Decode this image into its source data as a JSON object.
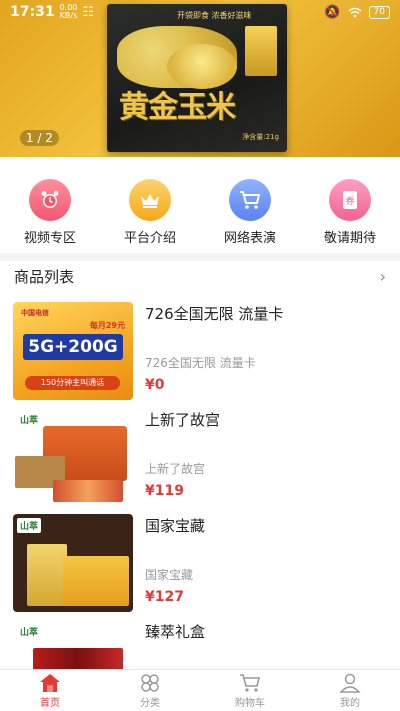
{
  "status_bar": {
    "time": "17:31",
    "speed": "0.00",
    "speed_unit": "KB/s",
    "battery": "70"
  },
  "banner": {
    "page_indicator": "1 / 2",
    "product_name": "黄金玉米",
    "tagline": "开袋即食 浓香好滋味",
    "weight": "净含量:21g"
  },
  "quick_nav": [
    {
      "label": "视频专区",
      "icon": "alarm-clock-icon",
      "color": "#f2576e"
    },
    {
      "label": "平台介绍",
      "icon": "crown-icon",
      "color": "#f4a918"
    },
    {
      "label": "网络表演",
      "icon": "shopping-cart-icon",
      "color": "#5b82f0"
    },
    {
      "label": "敬请期待",
      "icon": "ticket-icon",
      "color": "#f2628f"
    }
  ],
  "section": {
    "title": "商品列表",
    "arrow": "›"
  },
  "products": [
    {
      "title": "726全国无限 流量卡",
      "subtitle": "726全国无限 流量卡",
      "price": "¥0",
      "thumb": {
        "sim_text": "5G+200G",
        "logo": "中国电信",
        "monthly": "每月29元",
        "calls": "150分钟主叫通话"
      }
    },
    {
      "title": "上新了故宫",
      "subtitle": "上新了故宫",
      "price": "¥119",
      "thumb": {
        "brand": "山萃"
      }
    },
    {
      "title": "国家宝藏",
      "subtitle": "国家宝藏",
      "price": "¥127",
      "thumb": {
        "brand": "山萃"
      }
    },
    {
      "title": "臻萃礼盒",
      "subtitle": "",
      "price": "",
      "thumb": {
        "brand": "山萃"
      }
    }
  ],
  "bottom_nav": [
    {
      "label": "首页",
      "icon": "home-icon",
      "active": true
    },
    {
      "label": "分类",
      "icon": "category-icon",
      "active": false
    },
    {
      "label": "购物车",
      "icon": "cart-icon",
      "active": false
    },
    {
      "label": "我的",
      "icon": "user-icon",
      "active": false
    }
  ],
  "colors": {
    "accent": "#e53935",
    "muted": "#999999"
  }
}
